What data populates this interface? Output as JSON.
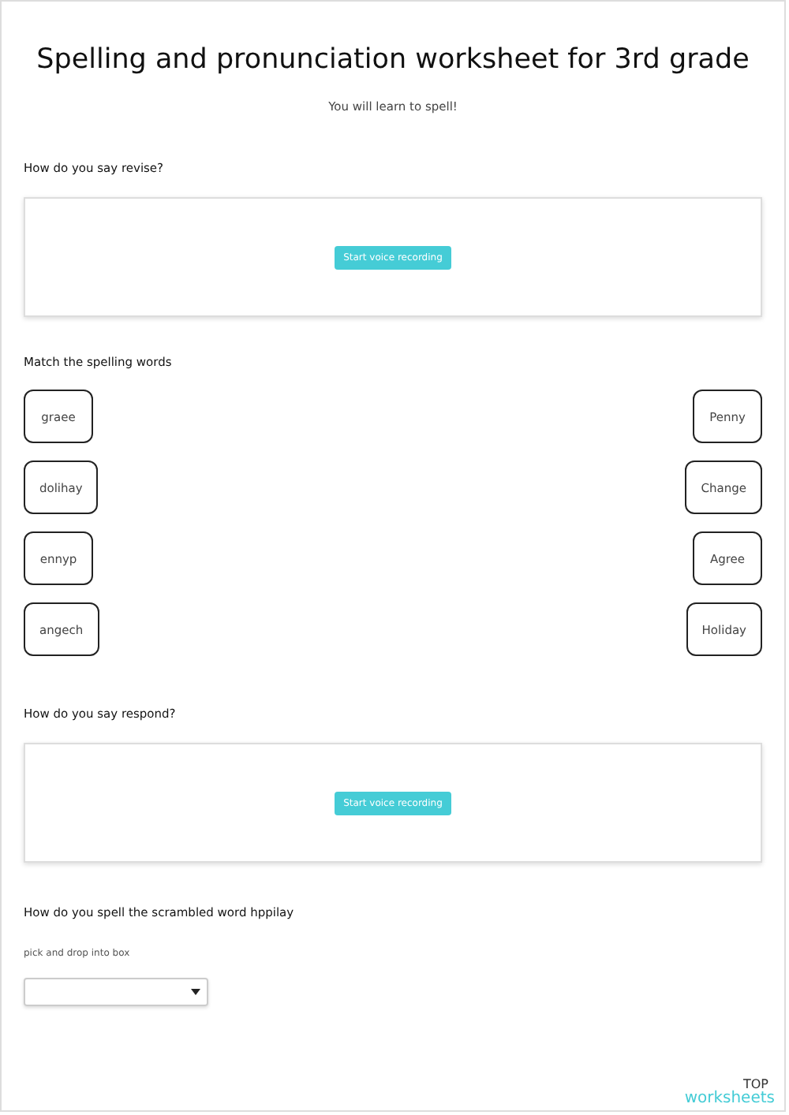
{
  "title": "Spelling and pronunciation worksheet for 3rd grade",
  "subtitle": "You will learn to spell!",
  "sections": [
    {
      "kind": "recording",
      "question": "How do you say revise?",
      "button": "Start voice recording"
    },
    {
      "kind": "matching",
      "question": "Match the spelling words",
      "left": [
        "graee",
        "dolihay",
        "ennyp",
        "angech"
      ],
      "right": [
        "Penny",
        "Change",
        "Agree",
        "Holiday"
      ]
    },
    {
      "kind": "recording",
      "question": "How do you say respond?",
      "button": "Start voice recording"
    },
    {
      "kind": "dropdown",
      "question": "How do you spell the scrambled word hppilay",
      "hint": "pick and drop into box"
    }
  ],
  "logo": {
    "top": "TOP",
    "bottom": "worksheets"
  }
}
